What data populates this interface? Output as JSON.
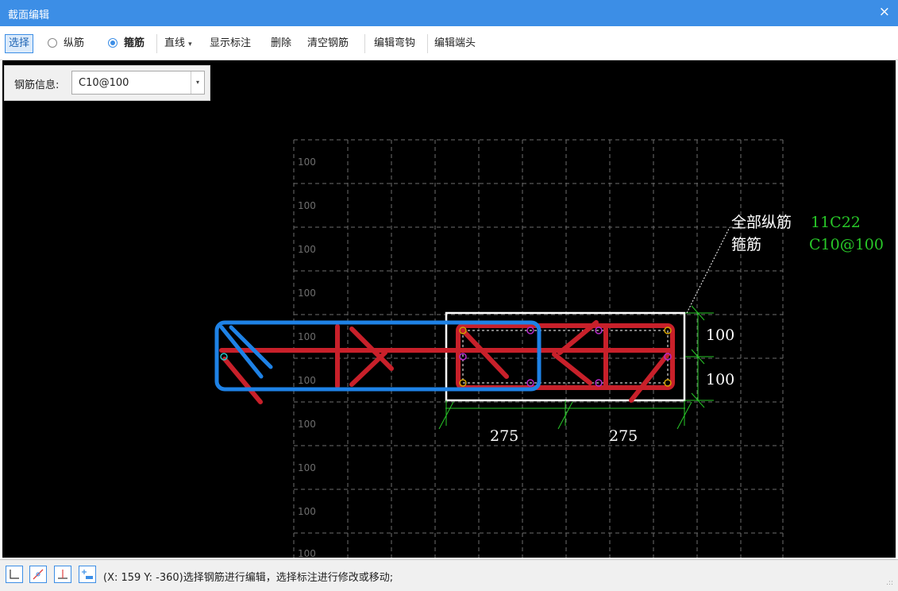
{
  "window": {
    "title": "截面编辑",
    "close_glyph": "×"
  },
  "toolbar": {
    "select_label": "选择",
    "radio_longitudinal": "纵筋",
    "radio_stirrup": "箍筋",
    "line_label": "直线",
    "line_dropdown_glyph": "▾",
    "show_dim_label": "显示标注",
    "delete_label": "删除",
    "clear_label": "清空钢筋",
    "edit_hook_label": "编辑弯钩",
    "edit_end_label": "编辑端头"
  },
  "info_panel": {
    "label": "钢筋信息:",
    "value": "C10@100",
    "dropdown_glyph": "▾"
  },
  "drawing": {
    "grid_labels": [
      "100",
      "100",
      "100",
      "100",
      "100",
      "100",
      "100",
      "100",
      "100",
      "100"
    ],
    "dim_vertical": [
      "100",
      "100"
    ],
    "dim_horizontal": [
      "275",
      "275"
    ],
    "annotation": {
      "line1_label": "全部纵筋",
      "line1_value": "11C22",
      "line2_label": "箍筋",
      "line2_value": "C10@100"
    },
    "colors": {
      "background": "#000000",
      "grid": "#6e6e6e",
      "stirrup_red": "#c8202a",
      "selected_blue": "#1e82e6",
      "section_outline": "#ffffff",
      "dimension_green": "#28c828",
      "annotation_white": "#ffffff",
      "annotation_green": "#28c828",
      "corner_bar": "#d2a000",
      "middle_bar": "#b428c8"
    }
  },
  "statusbar": {
    "message": "(X: 159 Y: -360)选择钢筋进行编辑，选择标注进行修改或移动;",
    "grip": ".::",
    "buttons": [
      "ortho-mode-icon",
      "snap-line-icon",
      "perpendicular-icon",
      "add-dimension-icon"
    ]
  }
}
